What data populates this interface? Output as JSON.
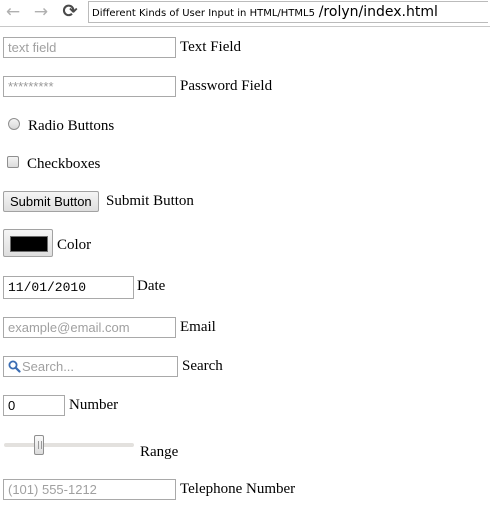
{
  "browser": {
    "back_icon": "←",
    "forward_icon": "→",
    "reload_icon": "⟳",
    "page_title": "Different Kinds of User Input in HTML/HTML5",
    "url_path": "/rolyn/index.html"
  },
  "form": {
    "text_field": {
      "placeholder": "text field",
      "label": "Text Field"
    },
    "password_field": {
      "value": "*********",
      "label": "Password Field"
    },
    "radio": {
      "label": "Radio Buttons"
    },
    "checkbox": {
      "label": "Checkboxes"
    },
    "submit": {
      "button_label": "Submit Button",
      "label": "Submit Button"
    },
    "color": {
      "value": "#000000",
      "label": "Color"
    },
    "date": {
      "value": "11/01/2010",
      "label": "Date"
    },
    "email": {
      "placeholder": "example@email.com",
      "label": "Email"
    },
    "search": {
      "placeholder": "Search...",
      "label": "Search"
    },
    "number": {
      "value": "0",
      "label": "Number"
    },
    "range": {
      "value": 0.25,
      "label": "Range"
    },
    "telephone": {
      "placeholder": "(101) 555-1212",
      "label": "Telephone Number"
    }
  }
}
